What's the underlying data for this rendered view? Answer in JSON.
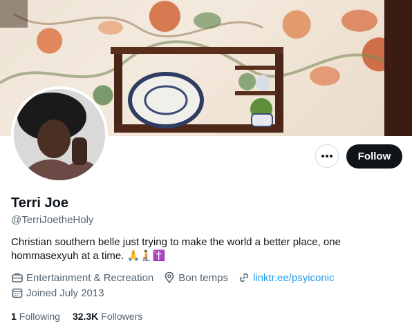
{
  "profile": {
    "name": "Terri Joe",
    "handle": "@TerriJoetheHoly",
    "bio_text": "Christian southern belle just trying to make the world a better place, one hommasexyuh at a time.",
    "bio_emojis": "🙏🧎✝️",
    "category": "Entertainment & Recreation",
    "location": "Bon temps",
    "link": "linktr.ee/psyiconic",
    "joined": "Joined July 2013"
  },
  "actions": {
    "more_label": "•••",
    "follow_label": "Follow"
  },
  "stats": {
    "following_count": "1",
    "following_label": "Following",
    "followers_count": "32.3K",
    "followers_label": "Followers"
  },
  "icons": {
    "category": "briefcase-icon",
    "location": "location-pin-icon",
    "link": "link-icon",
    "joined": "calendar-icon",
    "more": "more-dots-icon"
  },
  "colors": {
    "follow_bg": "#0f1419",
    "link": "#1d9bf0",
    "secondary_text": "#536471"
  }
}
